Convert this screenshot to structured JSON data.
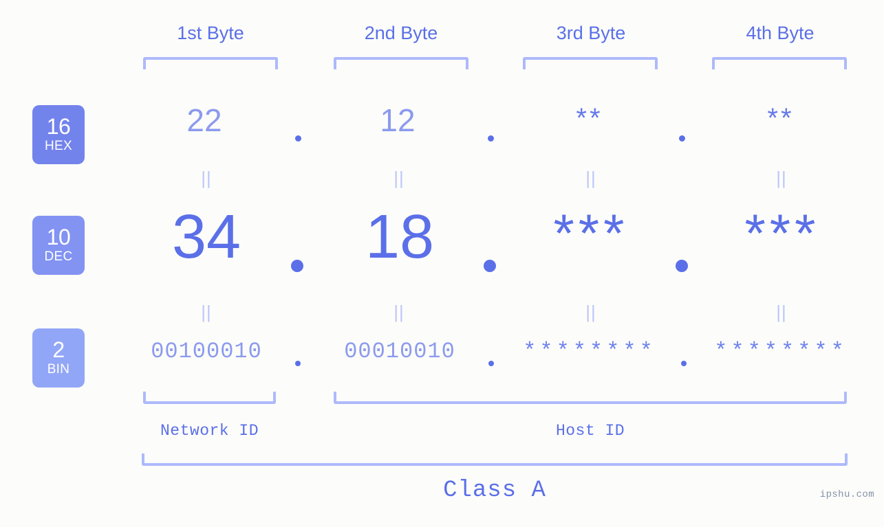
{
  "meta": {
    "background_color": "#fcfdfa",
    "accent_color": "#5b6fe8",
    "accent_light_color": "#8c9aee",
    "bracket_color": "#aeb9fb",
    "watermark": "ipshu.com"
  },
  "headers": [
    {
      "label": "1st Byte"
    },
    {
      "label": "2nd Byte"
    },
    {
      "label": "3rd Byte"
    },
    {
      "label": "4th Byte"
    }
  ],
  "bases": [
    {
      "num": "16",
      "abbr": "HEX",
      "color": "#7383ec"
    },
    {
      "num": "10",
      "abbr": "DEC",
      "color": "#8293f2"
    },
    {
      "num": "2",
      "abbr": "BIN",
      "color": "#92a6f7"
    }
  ],
  "rows": {
    "hex": {
      "values": [
        "22",
        "12",
        "**",
        "**"
      ],
      "separators": [
        ".",
        ".",
        "."
      ]
    },
    "dec": {
      "values": [
        "34",
        "18",
        "***",
        "***"
      ],
      "separators": [
        ".",
        ".",
        "."
      ]
    },
    "bin": {
      "values": [
        "00100010",
        "00010010",
        "********",
        "********"
      ],
      "separators": [
        ".",
        ".",
        "."
      ]
    }
  },
  "equals_marker": "||",
  "segments": {
    "network_id": "Network ID",
    "host_id": "Host ID",
    "class": "Class A"
  }
}
